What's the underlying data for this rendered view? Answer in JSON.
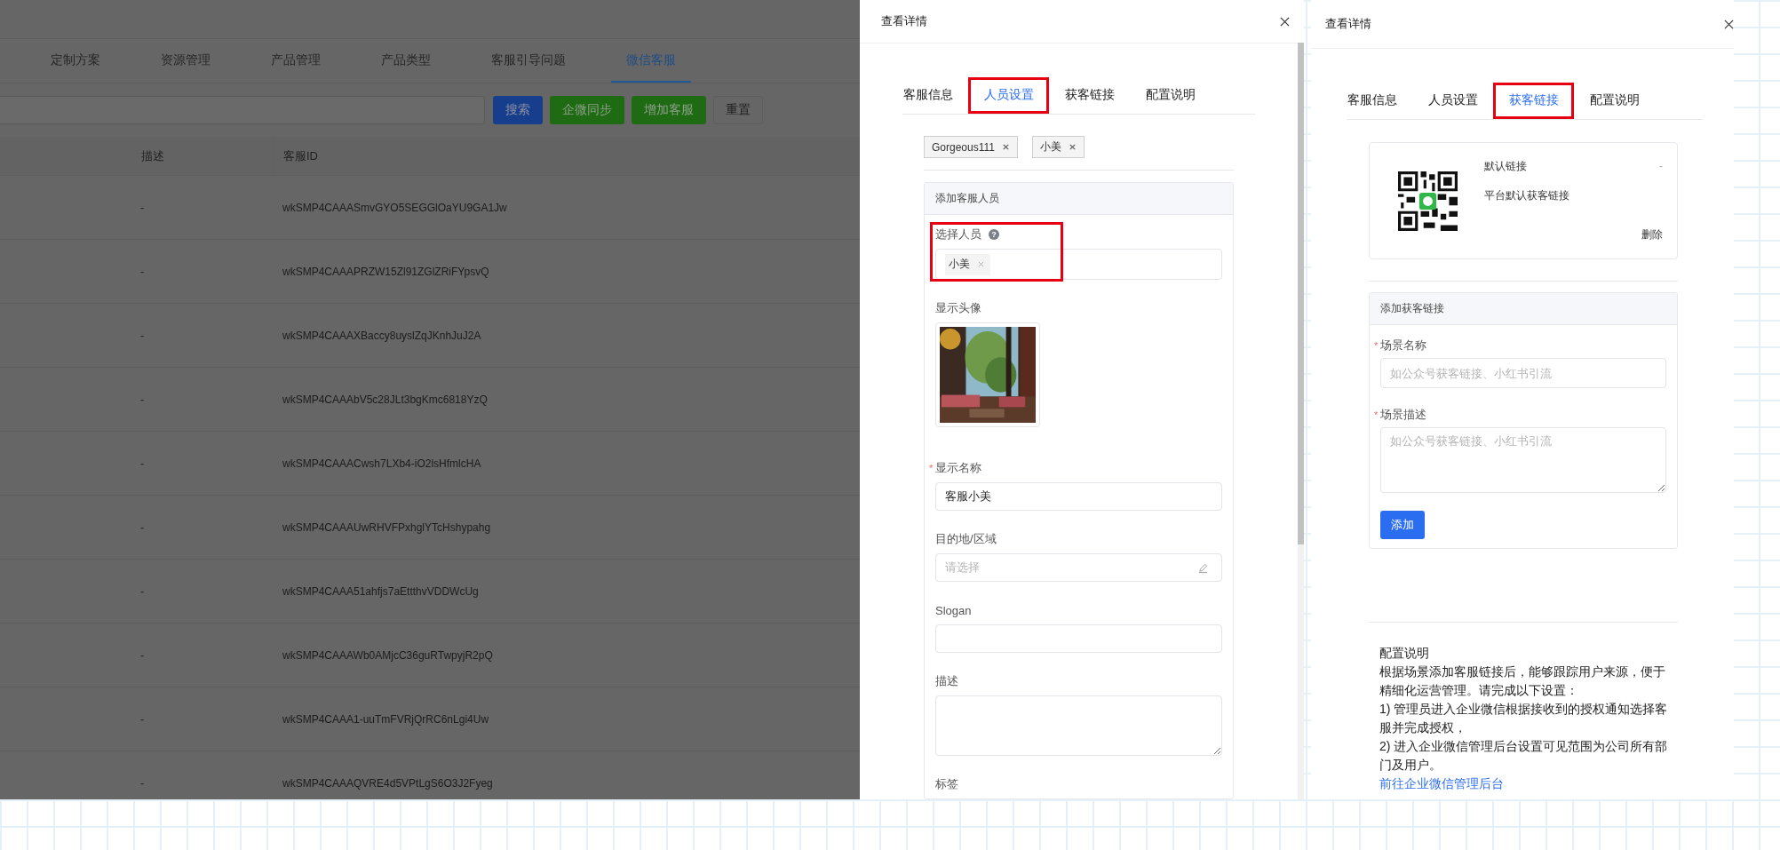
{
  "list_page": {
    "tabs": [
      {
        "label": "定制方案",
        "selected": false
      },
      {
        "label": "资源管理",
        "selected": false
      },
      {
        "label": "产品管理",
        "selected": false
      },
      {
        "label": "产品类型",
        "selected": false
      },
      {
        "label": "客服引导问题",
        "selected": false
      },
      {
        "label": "微信客服",
        "selected": true
      }
    ],
    "buttons": [
      {
        "label": "搜索",
        "kind": "primary"
      },
      {
        "label": "企微同步",
        "kind": "success"
      },
      {
        "label": "增加客服",
        "kind": "success"
      },
      {
        "label": "重置",
        "kind": "default"
      }
    ],
    "columns": [
      "描述",
      "客服ID"
    ],
    "rows": [
      {
        "description": "-",
        "id": "wkSMP4CAAASmvGYO5SEGGlOaYU9GA1Jw"
      },
      {
        "description": "-",
        "id": "wkSMP4CAAAPRZW15Zl91ZGlZRiFYpsvQ"
      },
      {
        "description": "-",
        "id": "wkSMP4CAAAXBaccy8uyslZqJKnhJuJ2A"
      },
      {
        "description": "-",
        "id": "wkSMP4CAAAbV5c28JLt3bgKmc6818YzQ"
      },
      {
        "description": "-",
        "id": "wkSMP4CAAACwsh7LXb4-iO2lsHfmlcHA"
      },
      {
        "description": "-",
        "id": "wkSMP4CAAAUwRHVFPxhglYTcHshypahg"
      },
      {
        "description": "-",
        "id": "wkSMP4CAAA51ahfjs7aEttthvVDDWcUg"
      },
      {
        "description": "-",
        "id": "wkSMP4CAAAWb0AMjcC36guRTwpyjR2pQ"
      },
      {
        "description": "-",
        "id": "wkSMP4CAAA1-uuTmFVRjQrRC6nLgi4Uw"
      },
      {
        "description": "-",
        "id": "wkSMP4CAAAQVRE4d5VPtLgS6O3J2Fyeg"
      }
    ]
  },
  "staff_drawer": {
    "title": "查看详情",
    "tabs": [
      {
        "label": "客服信息",
        "selected": false,
        "highlighted": false
      },
      {
        "label": "人员设置",
        "selected": true,
        "highlighted": true
      },
      {
        "label": "获客链接",
        "selected": false,
        "highlighted": false
      },
      {
        "label": "配置说明",
        "selected": false,
        "highlighted": false
      }
    ],
    "chosen_staff": [
      "Gorgeous111",
      "小美"
    ],
    "panel_title": "添加客服人员",
    "fields": [
      {
        "kind": "select",
        "label": "选择人员",
        "help": "?",
        "tags": [
          "小美"
        ],
        "highlighted": true
      },
      {
        "kind": "avatar",
        "label": "显示头像"
      },
      {
        "kind": "input",
        "label": "显示名称",
        "required_mark": "*",
        "value": "客服小美"
      },
      {
        "kind": "picker",
        "label": "目的地/区域",
        "placeholder": "请选择"
      },
      {
        "kind": "input",
        "label": "Slogan"
      },
      {
        "kind": "textarea",
        "label": "描述"
      },
      {
        "kind": "label",
        "label": "标签"
      }
    ]
  },
  "link_drawer": {
    "title": "查看详情",
    "tabs": [
      {
        "label": "客服信息",
        "selected": false,
        "highlighted": false
      },
      {
        "label": "人员设置",
        "selected": false,
        "highlighted": false
      },
      {
        "label": "获客链接",
        "selected": true,
        "highlighted": true
      },
      {
        "label": "配置说明",
        "selected": false,
        "highlighted": false
      }
    ],
    "link_card": {
      "name": "默认链接",
      "status": "-",
      "description": "平台默认获客链接",
      "action": "删除"
    },
    "panel_title": "添加获客链接",
    "fields": [
      {
        "kind": "input",
        "label": "场景名称",
        "required_mark": "*",
        "placeholder": "如公众号获客链接、小红书引流"
      },
      {
        "kind": "textarea",
        "label": "场景描述",
        "required_mark": "*",
        "placeholder": "如公众号获客链接、小红书引流"
      }
    ],
    "submit": "添加",
    "notes": {
      "title": "配置说明",
      "lines": [
        "根据场景添加客服链接后，能够跟踪用户来源，便于精细化运营管理。请完成以下设置：",
        "1) 管理员进入企业微信根据接收到的授权通知选择客服并完成授权，",
        "2) 进入企业微信管理后台设置可见范围为公司所有部门及用户。"
      ],
      "link": "前往企业微信管理后台"
    }
  }
}
